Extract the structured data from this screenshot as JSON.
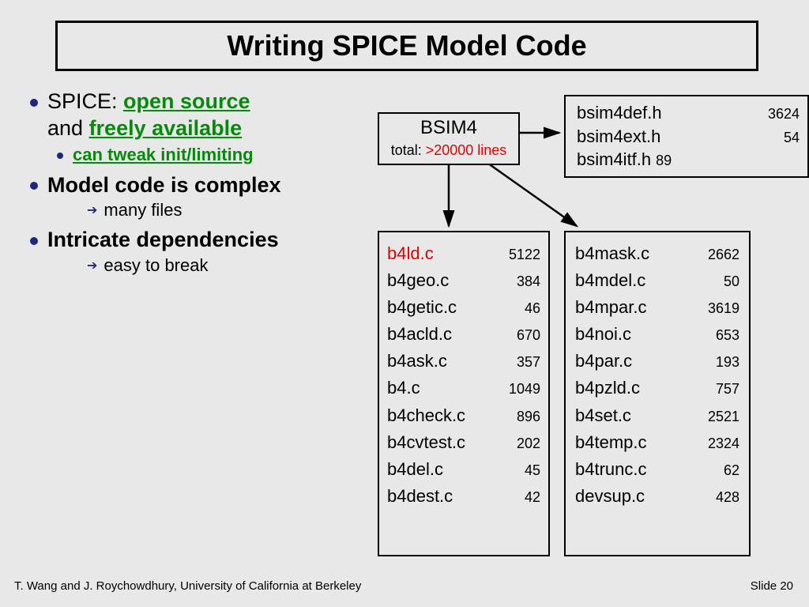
{
  "title": "Writing SPICE Model Code",
  "bullets": {
    "l1a_prefix": "SPICE: ",
    "l1a_green": "open source",
    "l1b_prefix": "and ",
    "l1b_green": "freely available",
    "l2a": "can tweak init/limiting",
    "l1c": "Model code is complex",
    "l3a": "many files",
    "l1d": "Intricate dependencies",
    "l3b": "easy to break"
  },
  "bsim": {
    "title": "BSIM4",
    "total_label": "total: ",
    "total_value": ">20000 lines"
  },
  "headers": [
    {
      "name": "bsim4def.h",
      "num": "3624"
    },
    {
      "name": "bsim4ext.h",
      "num": "54"
    },
    {
      "name": "bsim4itf.h",
      "num": "89"
    }
  ],
  "col1": [
    {
      "name": "b4ld.c",
      "num": "5122",
      "red": true
    },
    {
      "name": "b4geo.c",
      "num": "384"
    },
    {
      "name": "b4getic.c",
      "num": "46"
    },
    {
      "name": "b4acld.c",
      "num": "670"
    },
    {
      "name": "b4ask.c",
      "num": "357"
    },
    {
      "name": "b4.c",
      "num": "1049"
    },
    {
      "name": "b4check.c",
      "num": "896"
    },
    {
      "name": "b4cvtest.c",
      "num": "202"
    },
    {
      "name": "b4del.c",
      "num": "45"
    },
    {
      "name": "b4dest.c",
      "num": "42"
    }
  ],
  "col2": [
    {
      "name": "b4mask.c",
      "num": "2662"
    },
    {
      "name": "b4mdel.c",
      "num": "50"
    },
    {
      "name": "b4mpar.c",
      "num": "3619"
    },
    {
      "name": "b4noi.c",
      "num": "653"
    },
    {
      "name": "b4par.c",
      "num": "193"
    },
    {
      "name": "b4pzld.c",
      "num": "757"
    },
    {
      "name": "b4set.c",
      "num": "2521"
    },
    {
      "name": "b4temp.c",
      "num": "2324"
    },
    {
      "name": "b4trunc.c",
      "num": "62"
    },
    {
      "name": "devsup.c",
      "num": "428"
    }
  ],
  "footer": {
    "left": "T. Wang and J. Roychowdhury, University of California at Berkeley",
    "right_label": "Slide ",
    "right_num": "20"
  }
}
